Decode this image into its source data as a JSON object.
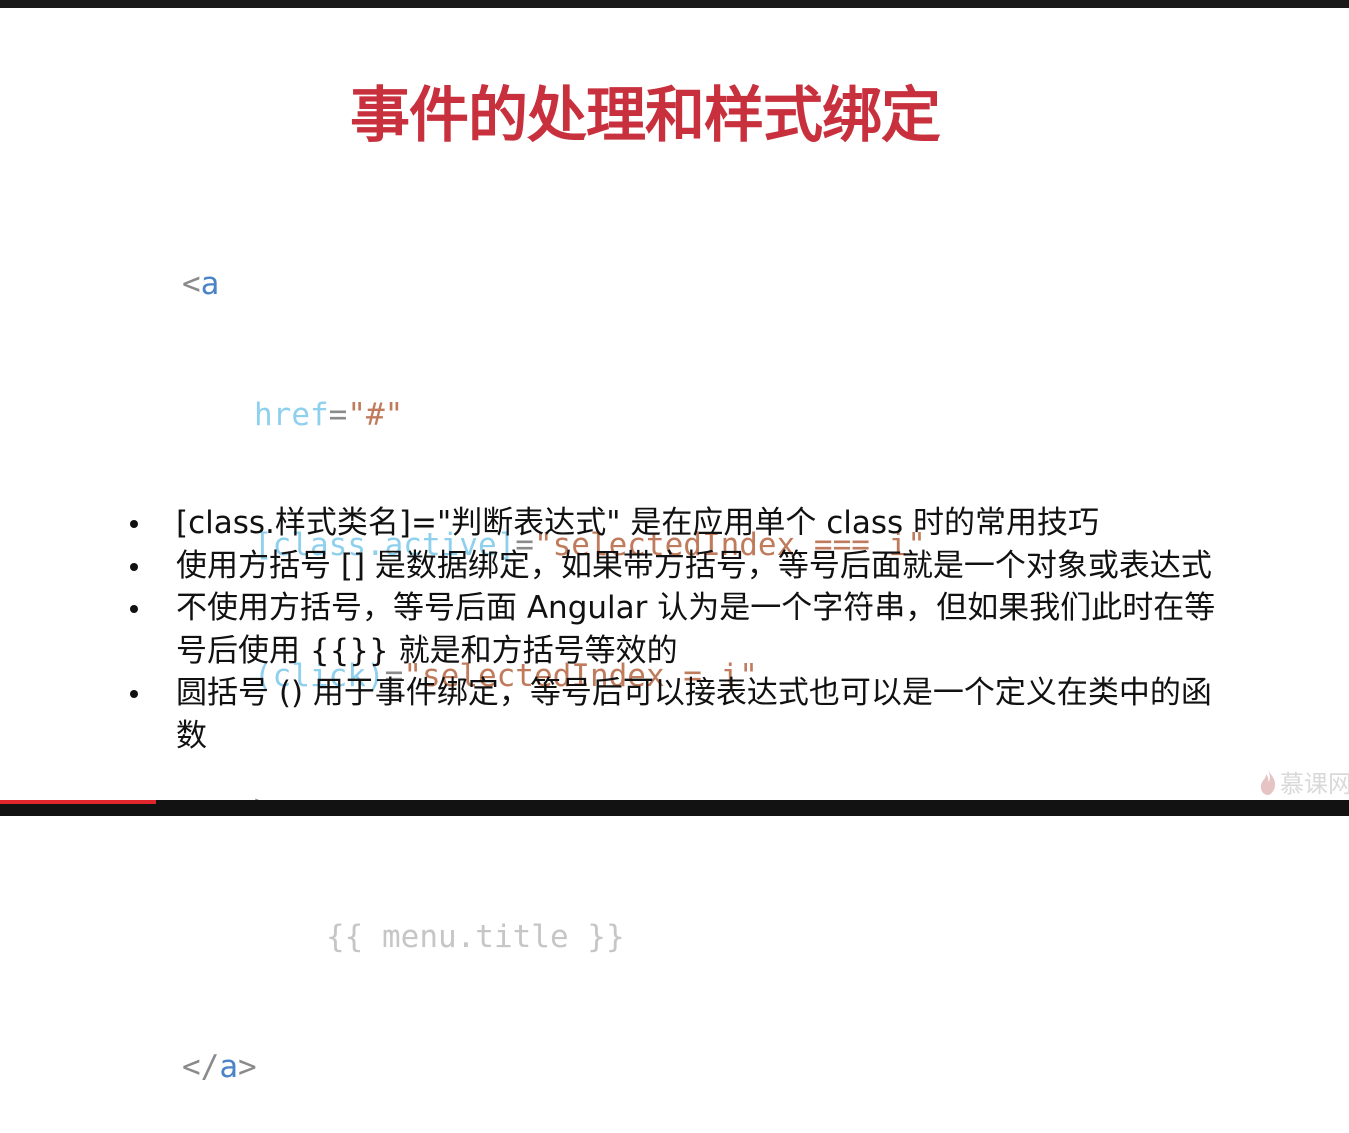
{
  "slide": {
    "title": "事件的处理和样式绑定"
  },
  "code": {
    "l1_open": "<",
    "l1_tag": "a",
    "l2_attr": "href",
    "l2_eq": "=",
    "l2_val": "\"#\"",
    "l3_attr": "[class.active]",
    "l3_eq": "=",
    "l3_val": "\"selectedIndex === i\"",
    "l4_attr": "(click)",
    "l4_eq": "=",
    "l4_val": "\"selectedIndex = i\"",
    "l5_close": ">",
    "l6_tpl": "{{ menu.title }}",
    "l7_open": "</",
    "l7_tag": "a",
    "l7_close": ">"
  },
  "bullets": [
    "[class.样式类名]=\"判断表达式\" 是在应用单个 class 时的常用技巧",
    "使用方括号 [] 是数据绑定，如果带方括号，等号后面就是一个对象或表达式",
    "不使用方括号，等号后面 Angular 认为是一个字符串，但如果我们此时在等号后使用 {{}} 就是和方括号等效的",
    "圆括号 () 用于事件绑定，等号后可以接表达式也可以是一个定义在类中的函数"
  ],
  "watermark": {
    "text": "慕课网",
    "icon": "flame-icon"
  },
  "colors": {
    "title": "#c8303d",
    "tag": "#4a84c6",
    "attr": "#8fd0ee",
    "string": "#c07b5c",
    "template": "#c6c6c6",
    "progress": "#e0262d"
  },
  "player": {
    "progress": 0.116
  }
}
